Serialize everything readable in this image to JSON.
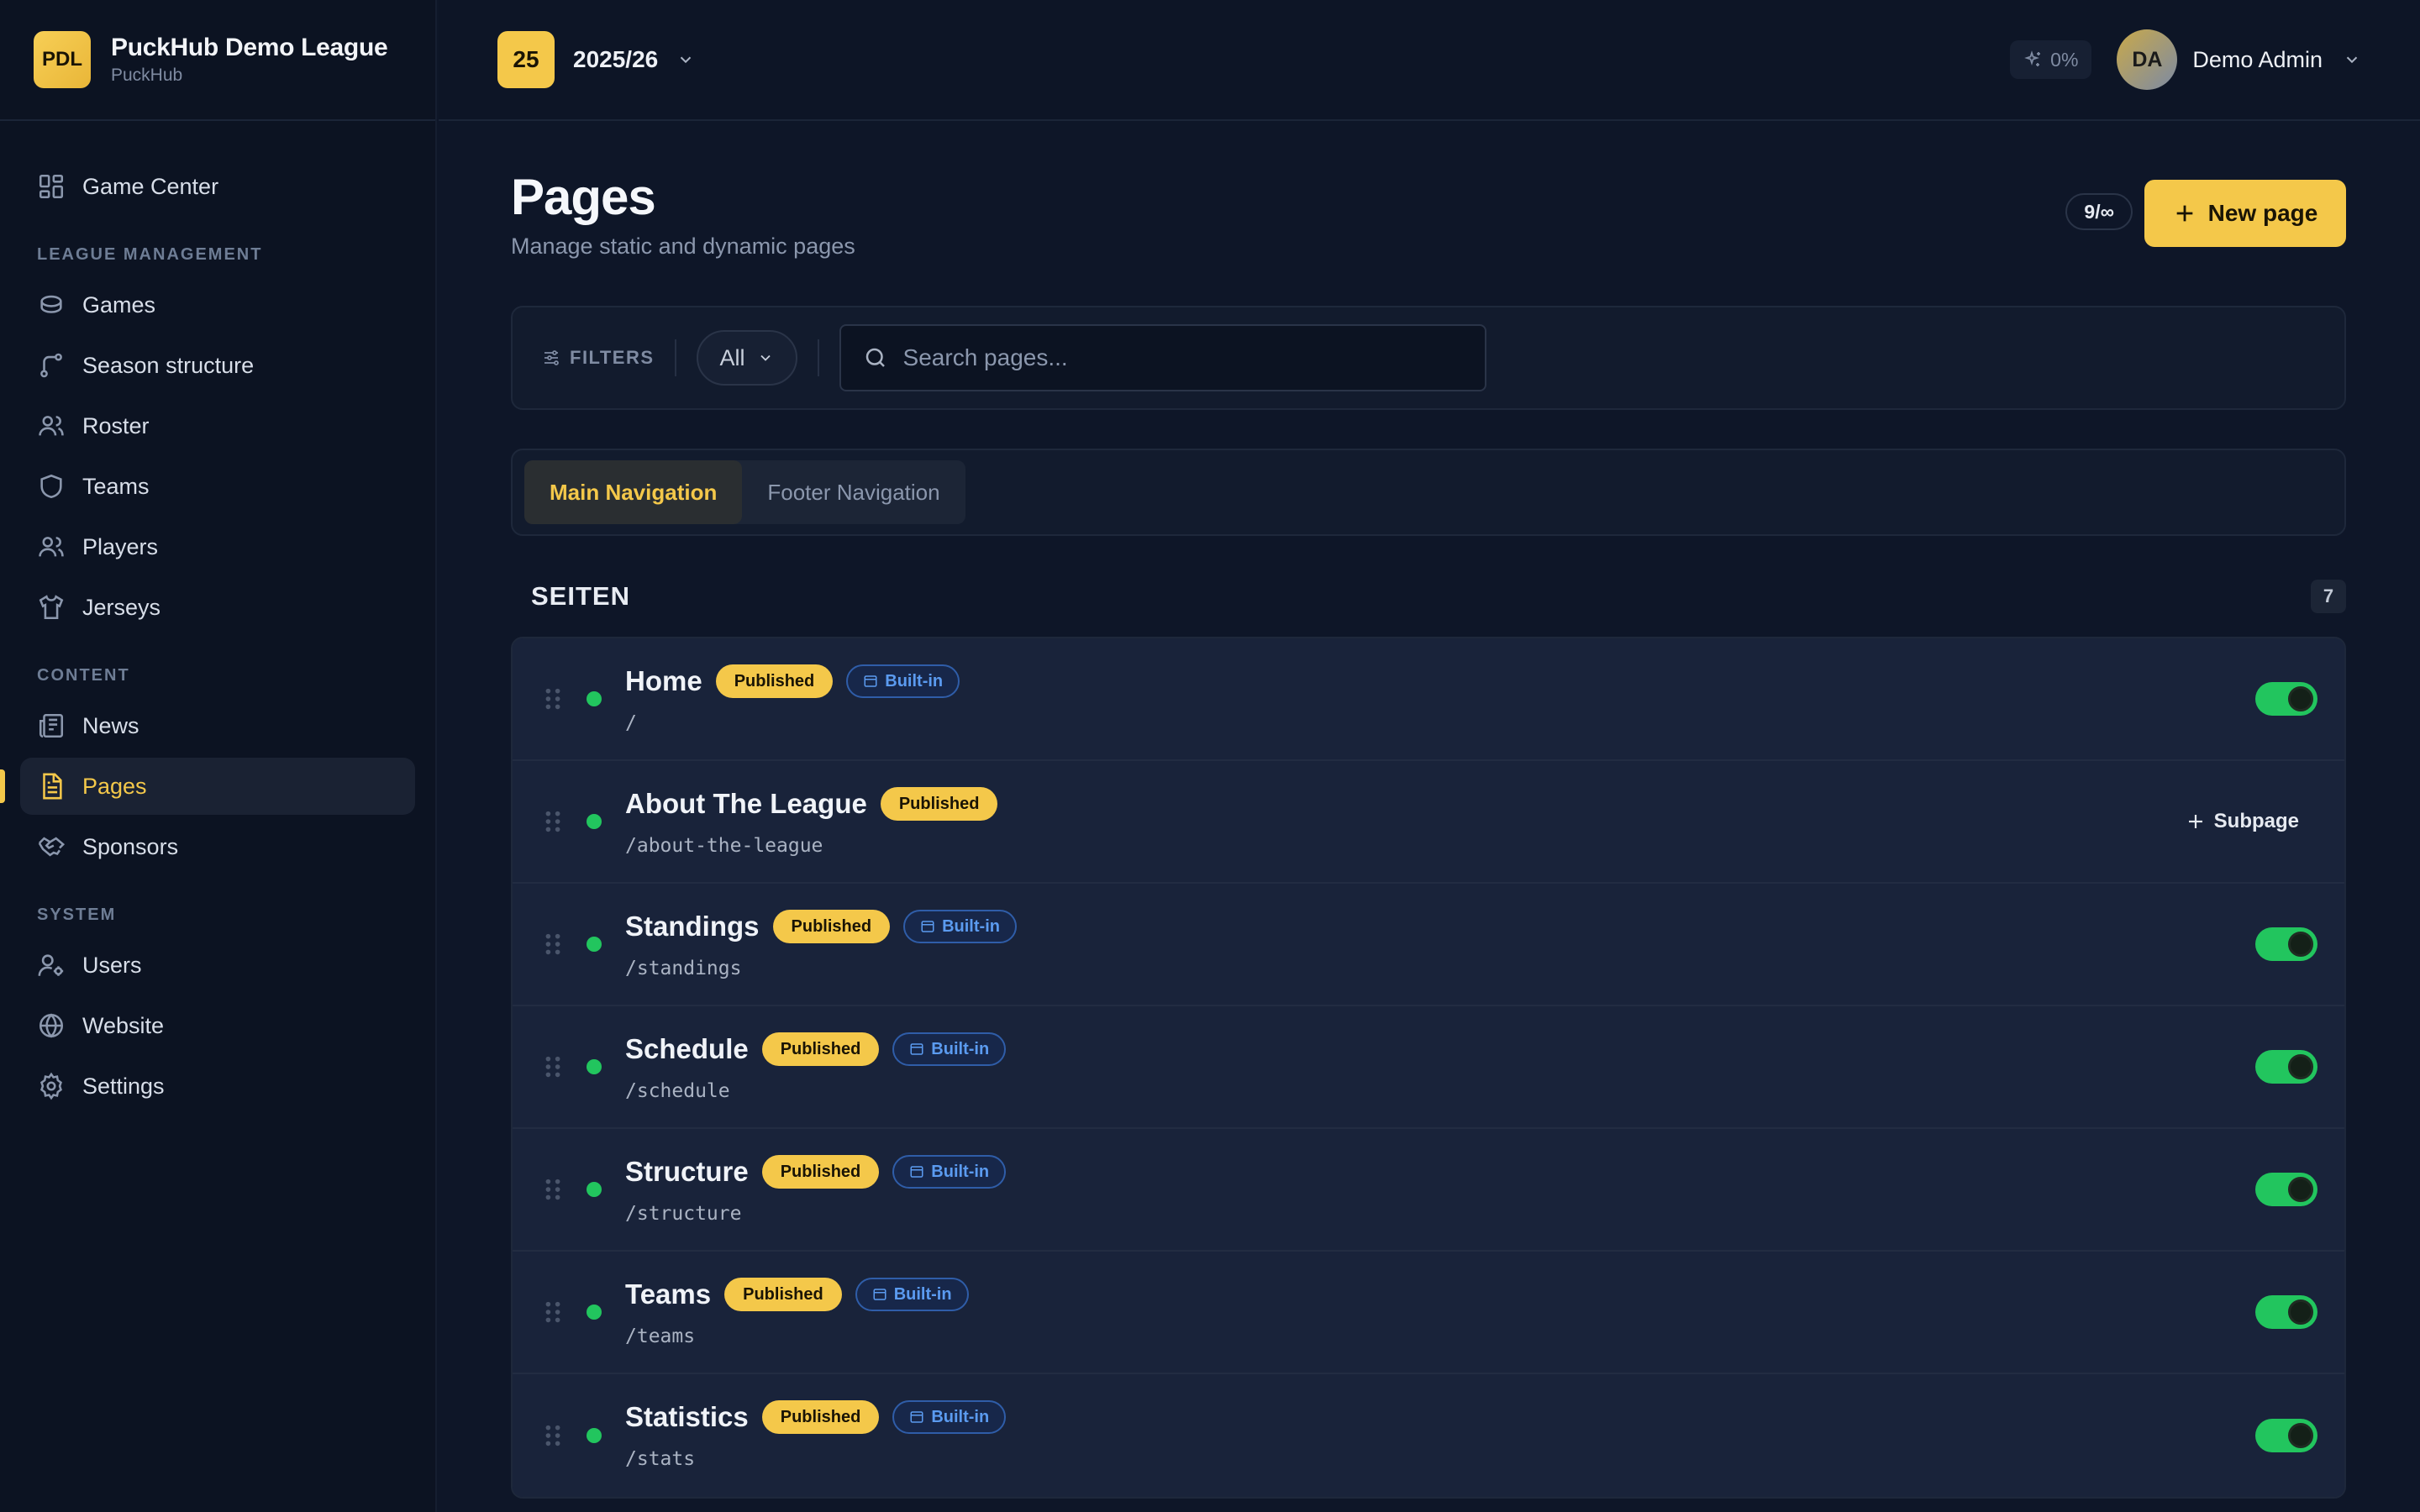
{
  "brand": {
    "logo": "PDL",
    "name": "PuckHub Demo League",
    "sub": "PuckHub"
  },
  "topbar": {
    "season_badge": "25",
    "season_label": "2025/26",
    "usage": "0%",
    "avatar_initials": "DA",
    "user_name": "Demo Admin"
  },
  "sidebar": {
    "top_item": {
      "label": "Game Center",
      "icon": "grid-icon"
    },
    "sections": [
      {
        "title": "LEAGUE MANAGEMENT"
      },
      {
        "title": "CONTENT"
      },
      {
        "title": "SYSTEM"
      }
    ],
    "items": [
      {
        "label": "Games",
        "icon": "puck-icon"
      },
      {
        "label": "Season structure",
        "icon": "branch-icon"
      },
      {
        "label": "Roster",
        "icon": "users-icon"
      },
      {
        "label": "Teams",
        "icon": "shield-icon"
      },
      {
        "label": "Players",
        "icon": "users-icon"
      },
      {
        "label": "Jerseys",
        "icon": "shirt-icon"
      },
      {
        "label": "News",
        "icon": "newspaper-icon"
      },
      {
        "label": "Pages",
        "icon": "file-text-icon"
      },
      {
        "label": "Sponsors",
        "icon": "handshake-icon"
      },
      {
        "label": "Users",
        "icon": "user-cog-icon"
      },
      {
        "label": "Website",
        "icon": "globe-icon"
      },
      {
        "label": "Settings",
        "icon": "gear-icon"
      }
    ]
  },
  "page": {
    "title": "Pages",
    "subtitle": "Manage static and dynamic pages",
    "quota": "9/∞",
    "new_button": "New page"
  },
  "filters": {
    "label": "FILTERS",
    "select_value": "All",
    "search_placeholder": "Search pages..."
  },
  "tabs": [
    {
      "label": "Main Navigation",
      "active": true
    },
    {
      "label": "Footer Navigation",
      "active": false
    }
  ],
  "section": {
    "title": "SEITEN",
    "count": "7"
  },
  "pages": [
    {
      "title": "Home",
      "path": "/",
      "status": "Published",
      "builtin": "Built-in",
      "enabled": true
    },
    {
      "title": "About The League",
      "path": "/about-the-league",
      "status": "Published",
      "subpage": "Subpage"
    },
    {
      "title": "Standings",
      "path": "/standings",
      "status": "Published",
      "builtin": "Built-in",
      "enabled": true
    },
    {
      "title": "Schedule",
      "path": "/schedule",
      "status": "Published",
      "builtin": "Built-in",
      "enabled": true
    },
    {
      "title": "Structure",
      "path": "/structure",
      "status": "Published",
      "builtin": "Built-in",
      "enabled": true
    },
    {
      "title": "Teams",
      "path": "/teams",
      "status": "Published",
      "builtin": "Built-in",
      "enabled": true
    },
    {
      "title": "Statistics",
      "path": "/stats",
      "status": "Published",
      "builtin": "Built-in",
      "enabled": true
    }
  ],
  "colors": {
    "accent": "#f4c84a",
    "success": "#22c55e",
    "info": "#5b9bf0",
    "background": "#0e1628"
  }
}
